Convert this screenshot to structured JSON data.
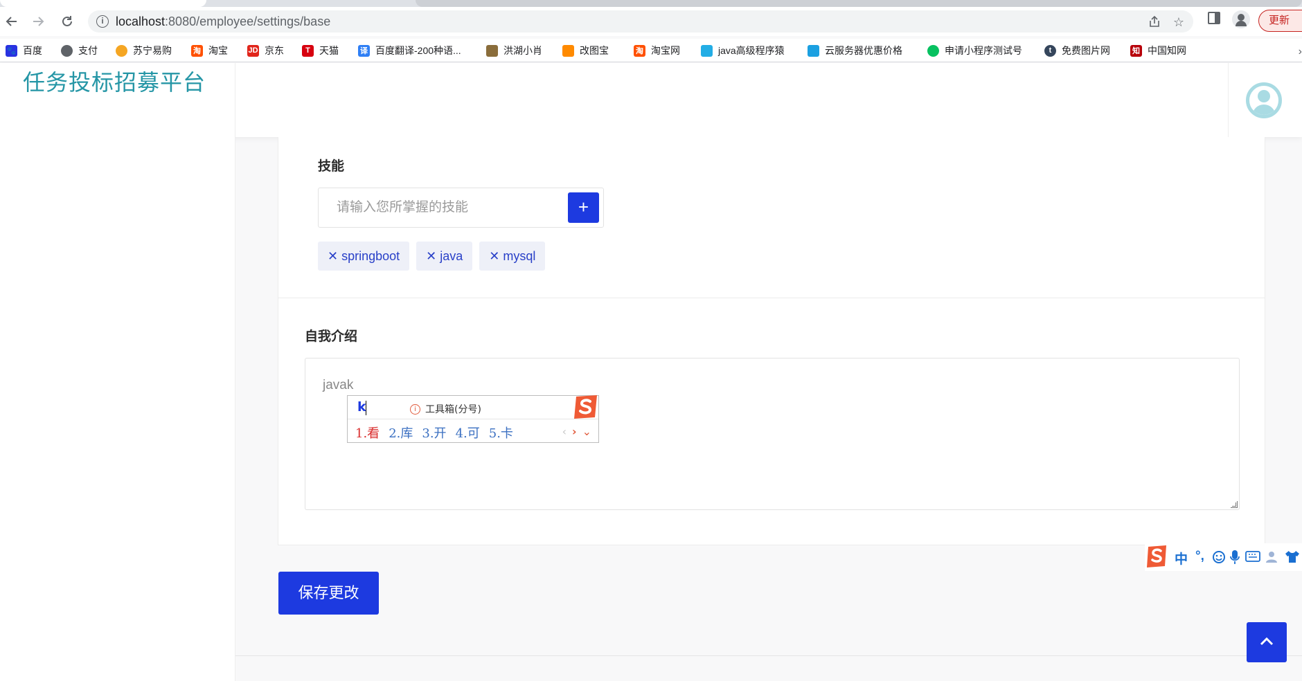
{
  "browser": {
    "url_host": "localhost",
    "url_path": ":8080/employee/settings/base",
    "update_label": "更新"
  },
  "bookmarks": [
    {
      "label": "百度",
      "icon": "baidu-icon",
      "color": "#2932e1"
    },
    {
      "label": "支付",
      "icon": "globe-icon",
      "color": "#5f6368"
    },
    {
      "label": "苏宁易购",
      "icon": "suning-icon",
      "color": "#f5a623"
    },
    {
      "label": "淘宝",
      "icon": "taobao-icon",
      "color": "#ff5000"
    },
    {
      "label": "京东",
      "icon": "jd-icon",
      "color": "#e1251b"
    },
    {
      "label": "天猫",
      "icon": "tmall-icon",
      "color": "#d7000f"
    },
    {
      "label": "百度翻译-200种语...",
      "icon": "translate-icon",
      "color": "#2f7ff5"
    },
    {
      "label": "洪湖小肖",
      "icon": "feather-icon",
      "color": "#8a6d3b"
    },
    {
      "label": "改图宝",
      "icon": "gaitubao-icon",
      "color": "#ff8a00"
    },
    {
      "label": "淘宝网",
      "icon": "taobao-icon",
      "color": "#ff5000"
    },
    {
      "label": "java高级程序猿",
      "icon": "bilibili-icon",
      "color": "#23ade5"
    },
    {
      "label": "云服务器优惠价格",
      "icon": "cloud-icon",
      "color": "#1ba0e1"
    },
    {
      "label": "申请小程序测试号",
      "icon": "wechat-icon",
      "color": "#07c160"
    },
    {
      "label": "免费图片网",
      "icon": "tumblr-icon",
      "color": "#35465c"
    },
    {
      "label": "中国知网",
      "icon": "cnki-icon",
      "color": "#b8000b"
    }
  ],
  "app": {
    "logo": "任务投标招募平台"
  },
  "skills": {
    "title": "技能",
    "placeholder": "请输入您所掌握的技能",
    "add_label": "+",
    "tags": [
      "springboot",
      "java",
      "mysql"
    ]
  },
  "intro": {
    "title": "自我介绍",
    "value": "javak"
  },
  "actions": {
    "save_label": "保存更改"
  },
  "ime": {
    "code": "k",
    "toolbox": "工具箱(分号)",
    "candidates": [
      "1.看",
      "2.库",
      "3.开",
      "4.可",
      "5.卡"
    ],
    "status": [
      "中",
      "°,"
    ]
  },
  "colors": {
    "primary": "#1d3ae0",
    "logo": "#2596a6",
    "tag_bg": "#eef0f8"
  }
}
